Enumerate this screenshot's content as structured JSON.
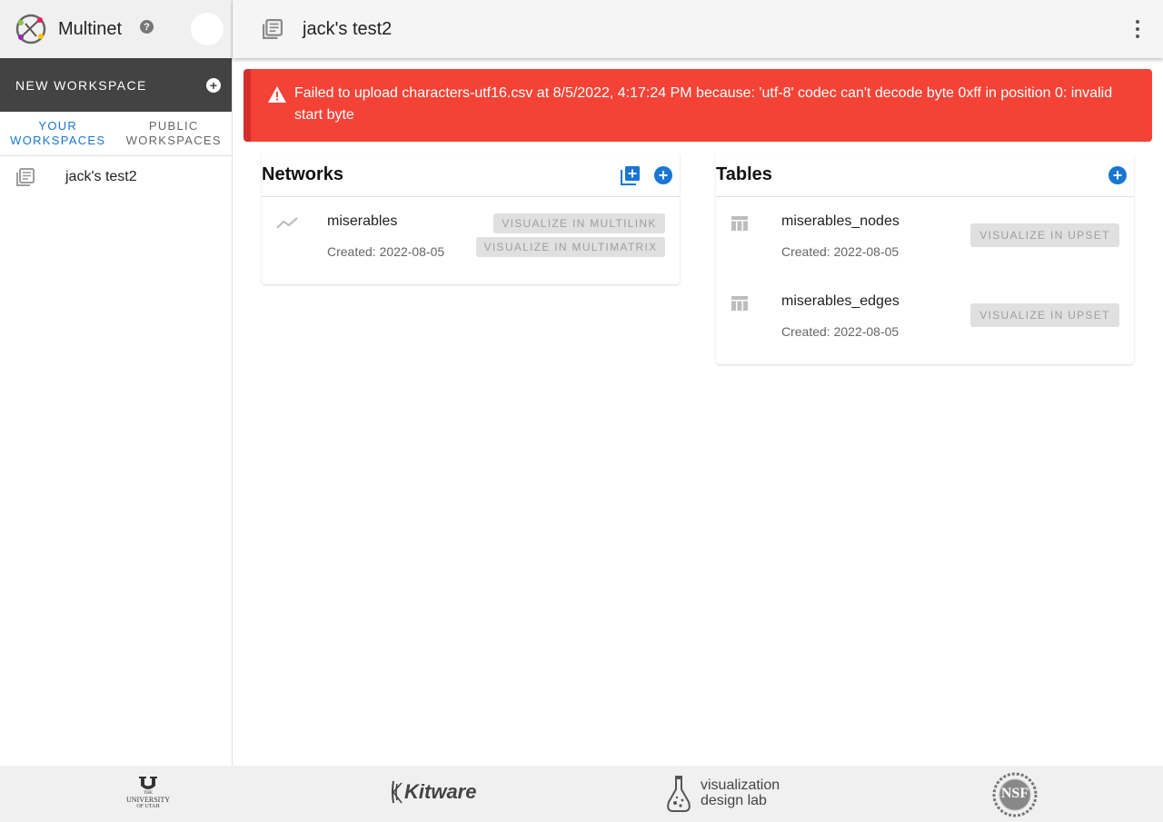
{
  "app": {
    "name": "Multinet",
    "help_label": "?"
  },
  "sidebar": {
    "new_workspace_label": "NEW WORKSPACE",
    "tabs": [
      {
        "label": "YOUR WORKSPACES",
        "active": true
      },
      {
        "label": "PUBLIC WORKSPACES",
        "active": false
      }
    ],
    "workspaces": [
      {
        "label": "jack's test2",
        "icon": "workspace-list-icon"
      }
    ]
  },
  "topbar": {
    "title": "jack's test2",
    "icon": "workspace-list-icon",
    "menu_icon": "more-vertical-icon"
  },
  "alert": {
    "icon": "warning-icon",
    "message": "Failed to upload characters-utf16.csv at 8/5/2022, 4:17:24 PM because: 'utf-8' codec can't decode byte 0xff in position 0: invalid start byte"
  },
  "networks": {
    "title": "Networks",
    "items": [
      {
        "name": "miserables",
        "created": "Created: 2022-08-05",
        "actions": [
          "VISUALIZE IN MULTILINK",
          "VISUALIZE IN MULTIMATRIX"
        ]
      }
    ]
  },
  "tables": {
    "title": "Tables",
    "items": [
      {
        "name": "miserables_nodes",
        "created": "Created: 2022-08-05",
        "action": "VISUALIZE IN UPSET"
      },
      {
        "name": "miserables_edges",
        "created": "Created: 2022-08-05",
        "action": "VISUALIZE IN UPSET"
      }
    ]
  },
  "footer": {
    "logos": [
      {
        "name": "university-of-utah-logo",
        "line1": "THE",
        "line2": "UNIVERSITY",
        "line3": "OF UTAH"
      },
      {
        "name": "kitware-logo",
        "text": "Kitware"
      },
      {
        "name": "visualization-design-lab-logo",
        "line1": "visualization",
        "line2": "design lab"
      },
      {
        "name": "nsf-logo",
        "text": "NSF"
      }
    ]
  },
  "colors": {
    "primary": "#1976d2",
    "error": "#f44336",
    "dark_button": "#434343"
  }
}
